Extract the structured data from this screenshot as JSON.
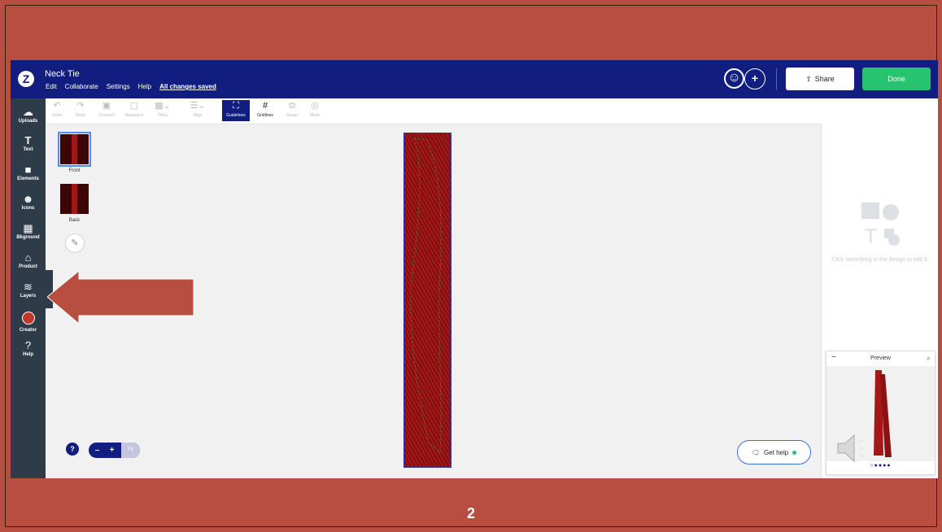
{
  "document": {
    "title": "Neck Tie",
    "menu": [
      "Edit",
      "Collaborate",
      "Settings",
      "Help"
    ],
    "save_status": "All changes saved"
  },
  "header": {
    "share_label": "Share",
    "done_label": "Done"
  },
  "sidebar": {
    "items": [
      {
        "label": "Uploads",
        "icon": "cloud-upload-icon"
      },
      {
        "label": "Text",
        "icon": "text-icon"
      },
      {
        "label": "Elements",
        "icon": "shapes-icon"
      },
      {
        "label": "Icons",
        "icon": "smiley-icon"
      },
      {
        "label": "Bkground",
        "icon": "background-icon"
      },
      {
        "label": "Product",
        "icon": "product-icon"
      },
      {
        "label": "Layers",
        "icon": "layers-icon"
      },
      {
        "label": "Creator",
        "icon": "creator-avatar-icon"
      },
      {
        "label": "Help",
        "icon": "help-icon"
      }
    ]
  },
  "toolbar": {
    "items": [
      {
        "label": "Undo",
        "icon": "undo-icon"
      },
      {
        "label": "Redo",
        "icon": "redo-icon"
      },
      {
        "label": "Forward",
        "icon": "forward-icon"
      },
      {
        "label": "Backward",
        "icon": "backward-icon"
      },
      {
        "label": "Tiling",
        "icon": "tiling-icon"
      },
      {
        "label": "Align",
        "icon": "align-icon"
      },
      {
        "label": "Guidelines",
        "icon": "guidelines-icon"
      },
      {
        "label": "Gridlines",
        "icon": "gridlines-icon"
      },
      {
        "label": "Group",
        "icon": "group-icon"
      },
      {
        "label": "Mask",
        "icon": "mask-icon"
      }
    ],
    "active": "Guidelines"
  },
  "pages": [
    {
      "label": "Front",
      "selected": true
    },
    {
      "label": "Back",
      "selected": false
    }
  ],
  "zoom": {
    "minus": "–",
    "plus": "+",
    "fit": "Fit"
  },
  "right_panel": {
    "empty_message": "Click something in the design to edit it."
  },
  "preview": {
    "title": "Preview"
  },
  "get_help": {
    "label": "Get help"
  },
  "slide": {
    "number": "2"
  },
  "colors": {
    "slide_background": "#b84e40",
    "topbar": "#111d7f",
    "sidebar": "#2e3b48",
    "done_button": "#27c46f",
    "tie_red": "#9f1616",
    "arrow": "#b84e40"
  }
}
